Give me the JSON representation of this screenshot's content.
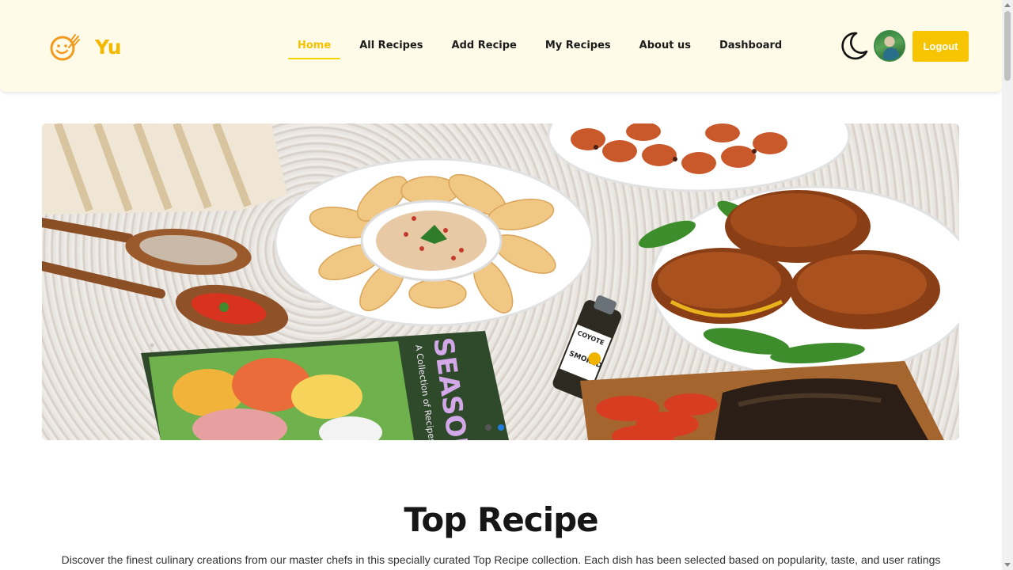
{
  "brand": {
    "name": "Yu",
    "logo_icon": "smiley-fork-icon",
    "accent": "#f5b800"
  },
  "nav": {
    "items": [
      {
        "label": "Home",
        "active": true
      },
      {
        "label": "All Recipes",
        "active": false
      },
      {
        "label": "Add Recipe",
        "active": false
      },
      {
        "label": "My Recipes",
        "active": false
      },
      {
        "label": "About us",
        "active": false
      },
      {
        "label": "Dashboard",
        "active": false
      }
    ],
    "theme_toggle_icon": "moon-icon",
    "avatar_icon": "user-avatar",
    "logout_label": "Logout",
    "logout_color": "#f6c400"
  },
  "hero": {
    "image": "food-spread-photo",
    "book_title": "SEASONED",
    "book_subtitle": "A Collection of Recipes to Benefit Wom",
    "bottle_brand": "COYOTE",
    "bottle_label": "SMOKED",
    "slides_count": 2,
    "active_slide": 2
  },
  "section": {
    "title": "Top Recipe",
    "description": "Discover the finest culinary creations from our master chefs in this specially curated Top Recipe collection. Each dish has been selected based on popularity, taste, and user ratings"
  }
}
